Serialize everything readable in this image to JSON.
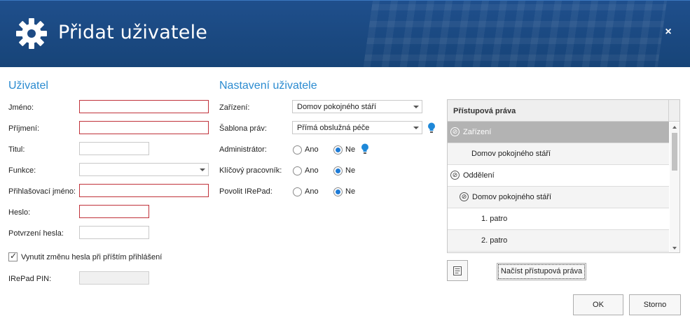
{
  "dialog": {
    "title": "Přidat uživatele",
    "close_label": "×"
  },
  "user_section": {
    "title": "Uživatel",
    "fields": {
      "first_name": {
        "label": "Jméno:",
        "value": ""
      },
      "last_name": {
        "label": "Příjmení:",
        "value": ""
      },
      "title": {
        "label": "Titul:",
        "value": ""
      },
      "function": {
        "label": "Funkce:",
        "value": ""
      },
      "login": {
        "label": "Přihlašovací jméno:",
        "value": ""
      },
      "password": {
        "label": "Heslo:",
        "value": ""
      },
      "password_confirm": {
        "label": "Potvrzení hesla:",
        "value": ""
      },
      "force_change": {
        "label": "Vynutit změnu hesla při příštím přihlášení",
        "checked": true
      },
      "irepad_pin": {
        "label": "IRePad PIN:",
        "value": ""
      }
    }
  },
  "settings_section": {
    "title": "Nastavení uživatele",
    "facility": {
      "label": "Zařízení:",
      "value": "Domov pokojného stáří"
    },
    "rights_template": {
      "label": "Šablona práv:",
      "value": "Přímá obslužná péče"
    },
    "administrator": {
      "label": "Administrátor:",
      "yes": "Ano",
      "no": "Ne",
      "selected": "Ne"
    },
    "key_worker": {
      "label": "Klíčový pracovník:",
      "yes": "Ano",
      "no": "Ne",
      "selected": "Ne"
    },
    "allow_irepad": {
      "label": "Povolit IRePad:",
      "yes": "Ano",
      "no": "Ne",
      "selected": "Ne"
    }
  },
  "rights_panel": {
    "header": "Přístupová práva",
    "rows": [
      {
        "text": "Zařízení",
        "expander": "⊘",
        "selected": true
      },
      {
        "text": "Domov pokojného stáří"
      },
      {
        "text": "Oddělení",
        "expander": "⊘"
      },
      {
        "text": "Domov pokojného stáří",
        "expander": "⊘"
      },
      {
        "text": "1. patro"
      },
      {
        "text": "2. patro"
      }
    ],
    "load_button": "Načíst přístupová práva"
  },
  "footer": {
    "ok": "OK",
    "cancel": "Storno"
  },
  "icons": {
    "gear": "gear-icon",
    "bulb": "lightbulb-icon",
    "list": "list-icon",
    "check": "✓"
  },
  "colors": {
    "header_bg": "#1f4f8c",
    "section_title": "#2b8bd0",
    "required_border": "#c0323a",
    "radio_dot": "#1e7bd6",
    "selected_row": "#b3b3b3"
  }
}
